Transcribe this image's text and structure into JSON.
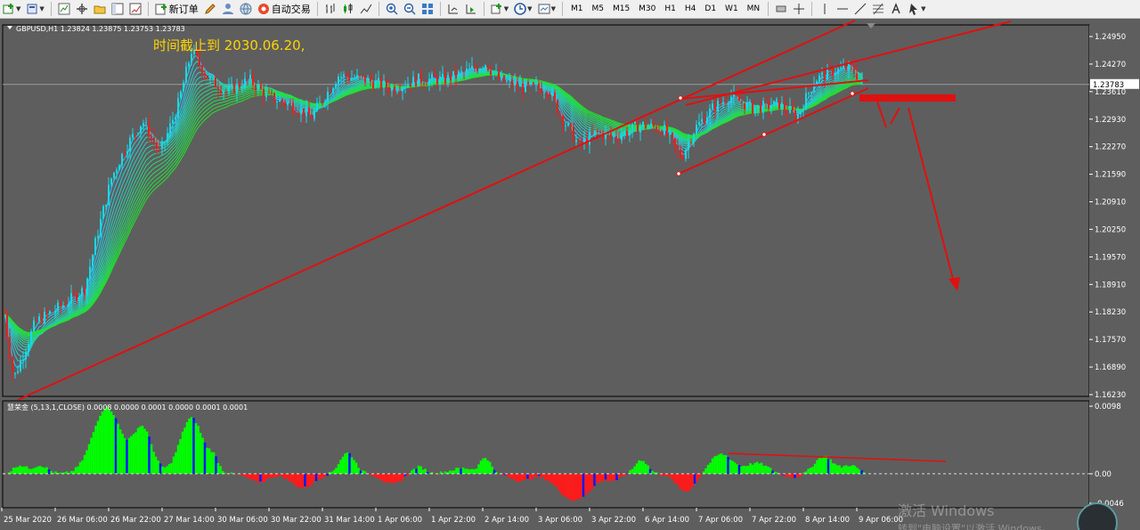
{
  "toolbar": {
    "new_order_label": "新订单",
    "auto_trading_label": "自动交易",
    "timeframes": [
      "M1",
      "M5",
      "M15",
      "M30",
      "H1",
      "H4",
      "D1",
      "W1",
      "MN"
    ]
  },
  "chart": {
    "header": "GBPUSD,H1  1.23824 1.23875 1.23753 1.23783",
    "annotation": "时间截止到 2030.06.20,",
    "current_price": "1.23783",
    "price_ticks": [
      "1.24950",
      "1.24270",
      "1.23610",
      "1.22930",
      "1.22270",
      "1.21590",
      "1.20910",
      "1.20250",
      "1.19570",
      "1.18910",
      "1.18230",
      "1.17570",
      "1.16890",
      "1.16230"
    ],
    "time_ticks": [
      "25 Mar 2020",
      "26 Mar 06:00",
      "26 Mar 22:00",
      "27 Mar 14:00",
      "30 Mar 06:00",
      "30 Mar 22:00",
      "31 Mar 14:00",
      "1 Apr 06:00",
      "1 Apr 22:00",
      "2 Apr 14:00",
      "3 Apr 06:00",
      "3 Apr 22:00",
      "6 Apr 14:00",
      "7 Apr 06:00",
      "7 Apr 22:00",
      "8 Apr 14:00",
      "9 Apr 06:00"
    ],
    "colors": {
      "background": "#5e5e5e",
      "bull": "#16d8e8",
      "bear": "#e82020",
      "ribbon_fast": "#29c6f0",
      "ribbon_slow": "#22e22a",
      "trendline": "#e01010",
      "text": "#ffffff",
      "note": "#ffd400"
    }
  },
  "indicator": {
    "header": "慧荣金 (5,13,1,CLOSE) 0.0008 0.0000 0.0001 0.0000 0.0001 0.0001",
    "ticks": [
      "0.0098",
      "0.00",
      "-0.0046"
    ],
    "colors": {
      "pos": "#00ff00",
      "neg": "#ff1a1a",
      "mid": "#0018ff"
    }
  },
  "overlay": {
    "watermark_line1": "激活 Windows",
    "watermark_line2": "转到\"电脑设置\"以激活 Windows。"
  }
}
